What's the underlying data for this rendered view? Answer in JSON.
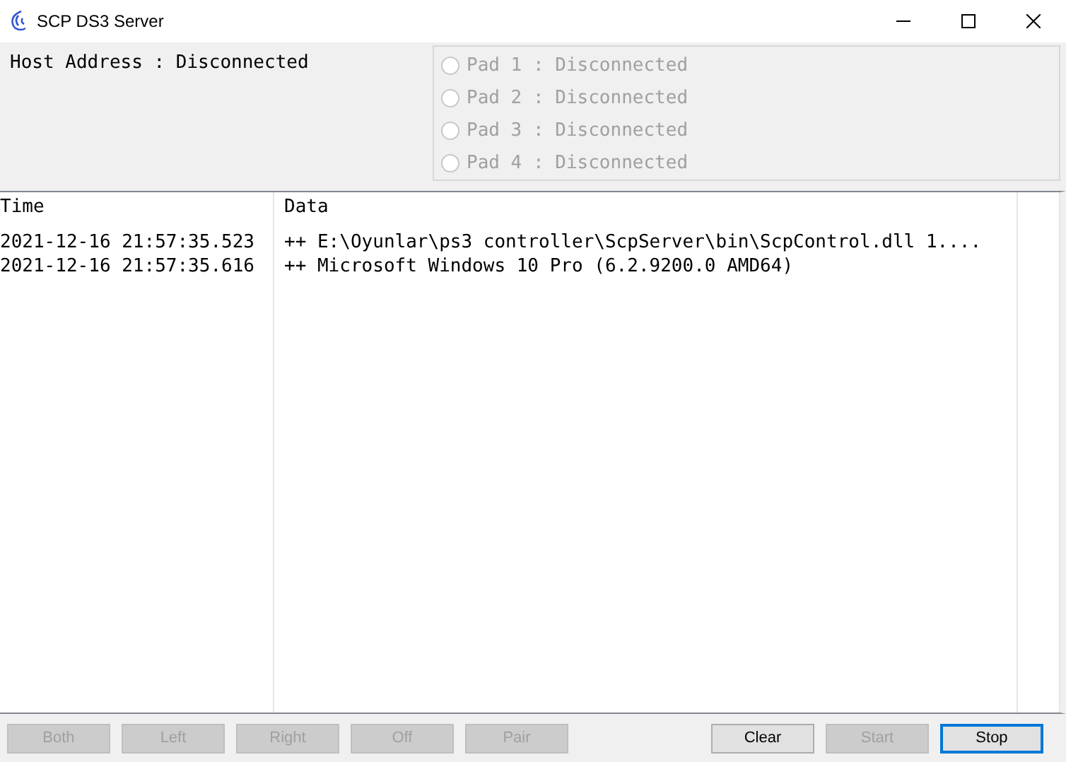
{
  "window": {
    "title": "SCP DS3 Server"
  },
  "host": {
    "label": "Host Address : Disconnected"
  },
  "pads": [
    {
      "label": "Pad 1 : Disconnected",
      "selected": false,
      "disabled": true
    },
    {
      "label": "Pad 2 : Disconnected",
      "selected": false,
      "disabled": true
    },
    {
      "label": "Pad 3 : Disconnected",
      "selected": false,
      "disabled": true
    },
    {
      "label": "Pad 4 : Disconnected",
      "selected": false,
      "disabled": true
    }
  ],
  "log": {
    "columns": [
      "Time",
      "Data"
    ],
    "rows": [
      [
        "2021-12-16 21:57:35.523",
        "++ E:\\Oyunlar\\ps3 controller\\ScpServer\\bin\\ScpControl.dll 1...."
      ],
      [
        "2021-12-16 21:57:35.616",
        "++ Microsoft Windows 10 Pro (6.2.9200.0 AMD64)"
      ]
    ]
  },
  "buttons_left": [
    {
      "label": "Both",
      "disabled": true
    },
    {
      "label": "Left",
      "disabled": true
    },
    {
      "label": "Right",
      "disabled": true
    },
    {
      "label": "Off",
      "disabled": true
    },
    {
      "label": "Pair",
      "disabled": true
    }
  ],
  "buttons_right": [
    {
      "label": "Clear",
      "disabled": false,
      "focused": false
    },
    {
      "label": "Start",
      "disabled": true,
      "focused": false
    },
    {
      "label": "Stop",
      "disabled": false,
      "focused": true
    }
  ]
}
